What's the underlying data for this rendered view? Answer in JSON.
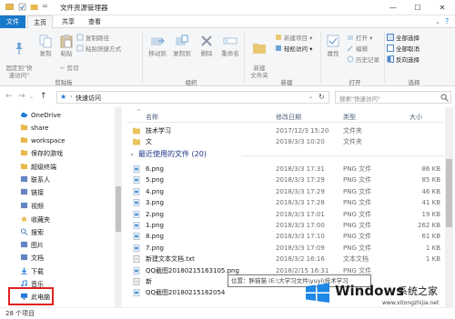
{
  "window": {
    "title": "文件资源管理器",
    "quick_access_arrow": "=",
    "minimize": "—",
    "maximize": "☐",
    "close": "✕"
  },
  "ribbon_tabs": [
    "文件",
    "主页",
    "共享",
    "查看"
  ],
  "ribbon": {
    "pin_label": "固定到\"快\n速访问\"",
    "copy_label": "复制",
    "paste_label": "粘贴",
    "copy_path": "复制路径",
    "paste_shortcut": "粘贴快捷方式",
    "cut": "剪切",
    "clipboard_group": "剪贴板",
    "move_to": "移动到",
    "copy_to": "复制到",
    "delete": "删除",
    "rename": "重命名",
    "organize_group": "组织",
    "new_folder": "新建\n文件夹",
    "new_item": "新建项目",
    "easy_access": "轻松访问",
    "new_group": "新建",
    "properties": "属性",
    "open": "打开",
    "edit": "编辑",
    "history": "历史记录",
    "open_group": "打开",
    "select_all": "全部选择",
    "select_none": "全部取消",
    "invert_selection": "反向选择",
    "select_group": "选择"
  },
  "address": {
    "back": "←",
    "forward": "→",
    "up": "↑",
    "path": "快速访问",
    "refresh": "↻",
    "search_placeholder": "搜索\"快速访问\""
  },
  "nav_items": [
    {
      "label": "OneDrive",
      "icon": "cloud-icon",
      "color": "#1e7bd6"
    },
    {
      "label": "share",
      "icon": "folder-icon",
      "color": "#e8b84a"
    },
    {
      "label": "workspace",
      "icon": "folder-icon",
      "color": "#e8b84a"
    },
    {
      "label": "保存的游戏",
      "icon": "game-folder-icon",
      "color": "#e8b84a"
    },
    {
      "label": "超级终端",
      "icon": "folder-icon",
      "color": "#e8b84a"
    },
    {
      "label": "联系人",
      "icon": "contacts-icon",
      "color": "#4a6fb5"
    },
    {
      "label": "链接",
      "icon": "link-icon",
      "color": "#4a6fb5"
    },
    {
      "label": "视频",
      "icon": "video-icon",
      "color": "#4a6fb5"
    },
    {
      "label": "收藏夹",
      "icon": "star-icon",
      "color": "#e8b84a"
    },
    {
      "label": "搜索",
      "icon": "search-icon",
      "color": "#4a6fb5"
    },
    {
      "label": "图片",
      "icon": "pictures-icon",
      "color": "#4a6fb5"
    },
    {
      "label": "文档",
      "icon": "documents-icon",
      "color": "#4a6fb5"
    },
    {
      "label": "下载",
      "icon": "download-icon",
      "color": "#1e7bd6"
    },
    {
      "label": "音乐",
      "icon": "music-icon",
      "color": "#1e7bd6"
    },
    {
      "label": "此电脑",
      "icon": "computer-icon",
      "color": "#1e7bd6"
    }
  ],
  "columns": {
    "name": "名称",
    "modified": "修改日期",
    "type": "类型",
    "size": "大小"
  },
  "folders": [
    {
      "name": "技术学习",
      "date": "2017/12/3 15:20",
      "type": "文件夹",
      "size": ""
    },
    {
      "name": "文",
      "date": "2018/3/3 10:20",
      "type": "文件夹",
      "size": ""
    }
  ],
  "recent_group_title": "最近使用的文件 (20)",
  "recent_files": [
    {
      "name": "6.png",
      "date": "2018/3/3 17:31",
      "type": "PNG 文件",
      "size": "86 KB",
      "icon": "image-file-icon"
    },
    {
      "name": "5.png",
      "date": "2018/3/3 17:29",
      "type": "PNG 文件",
      "size": "85 KB",
      "icon": "image-file-icon"
    },
    {
      "name": "4.png",
      "date": "2018/3/3 17:29",
      "type": "PNG 文件",
      "size": "46 KB",
      "icon": "image-file-icon"
    },
    {
      "name": "3.png",
      "date": "2018/3/3 17:28",
      "type": "PNG 文件",
      "size": "41 KB",
      "icon": "image-file-icon"
    },
    {
      "name": "2.png",
      "date": "2018/3/3 17:01",
      "type": "PNG 文件",
      "size": "19 KB",
      "icon": "image-file-icon"
    },
    {
      "name": "1.png",
      "date": "2018/3/3 17:00",
      "type": "PNG 文件",
      "size": "262 KB",
      "icon": "image-file-icon"
    },
    {
      "name": "8.png",
      "date": "2018/3/3 17:10",
      "type": "PNG 文件",
      "size": "61 KB",
      "icon": "image-file-icon"
    },
    {
      "name": "7.png",
      "date": "2018/3/3 17:09",
      "type": "PNG 文件",
      "size": "1 KB",
      "icon": "image-file-icon"
    },
    {
      "name": "新建文本文档.txt",
      "date": "2018/3/2 16:16",
      "type": "文本文档",
      "size": "1 KB",
      "icon": "text-file-icon"
    },
    {
      "name": "QQ截图20180215163105.png",
      "date": "2018/2/15 16:31",
      "type": "PNG 文件",
      "size": "",
      "icon": "image-file-icon"
    },
    {
      "name": "新",
      "date": "",
      "type": "",
      "size": "",
      "icon": "text-file-icon"
    },
    {
      "name": "QQ截图20180215162054",
      "date": "",
      "type": "",
      "size": "",
      "icon": "image-file-icon"
    }
  ],
  "tooltip": "位置：胖猫猫 (E:\\大学习文件\\yuyi\\技术学习",
  "status": {
    "item_count": "28 个项目"
  },
  "watermark": {
    "brand": "Windows",
    "site": "系统之家",
    "url": "www.xitongzhijia.net"
  }
}
